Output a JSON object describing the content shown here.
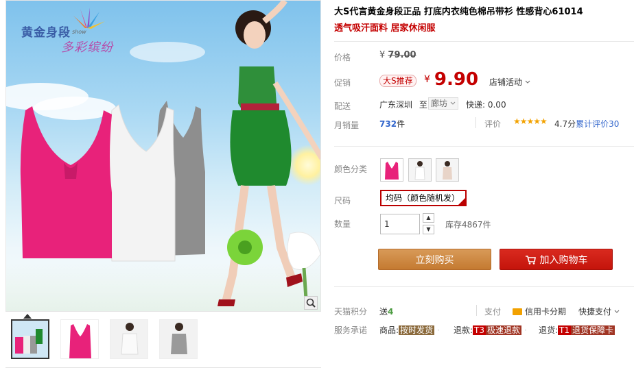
{
  "product": {
    "title": "大S代言黄金身段正品 打底内衣纯色棉吊带衫 性感背心61014",
    "subtitle": "透气吸汗面料 居家休闲服"
  },
  "brand": {
    "line1": "黄金身段",
    "line2": "多彩缤纷",
    "show": "show"
  },
  "price": {
    "label": "价格",
    "currency": "¥",
    "original": "79.00"
  },
  "promo": {
    "label": "促销",
    "badge": "大S推荐",
    "currency": "¥",
    "price": "9.90",
    "store_activity": "店铺活动"
  },
  "delivery": {
    "label": "配送",
    "from": "广东深圳",
    "to_word": "至",
    "to": "廊坊",
    "fee": "快递: 0.00"
  },
  "sales": {
    "label": "月销量",
    "count": "732",
    "unit": "件"
  },
  "rating": {
    "label": "评价",
    "stars": "★★★★★",
    "score": "4.7分",
    "count_text": "累计评价30"
  },
  "sku": {
    "color_label": "颜色分类",
    "colors": [
      "pink",
      "white",
      "grey"
    ],
    "size_label": "尺码",
    "size_option": "均码（颜色随机发）"
  },
  "quantity": {
    "label": "数量",
    "value": "1",
    "stock": "库存4867件"
  },
  "actions": {
    "buy_now": "立刻购买",
    "add_to_cart": "加入购物车"
  },
  "points": {
    "label": "天猫积分",
    "prefix": "送",
    "value": "4"
  },
  "payment": {
    "label": "支付",
    "credit": "信用卡分期",
    "fast": "快捷支付"
  },
  "service": {
    "label": "服务承诺",
    "item1_prefix": "商品:",
    "item1_tag": "按时发货",
    "item2_prefix": "退款:",
    "item2_code": "T3",
    "item2_tag": "极速退款",
    "item3_prefix": "退货:",
    "item3_code": "T1",
    "item3_tag": "退货保障卡"
  },
  "colors": {
    "accent_red": "#c40000",
    "buy_orange": "#c47a31",
    "cart_red": "#c4140b",
    "link_blue": "#3366cc",
    "star_orange": "#f3a200"
  }
}
